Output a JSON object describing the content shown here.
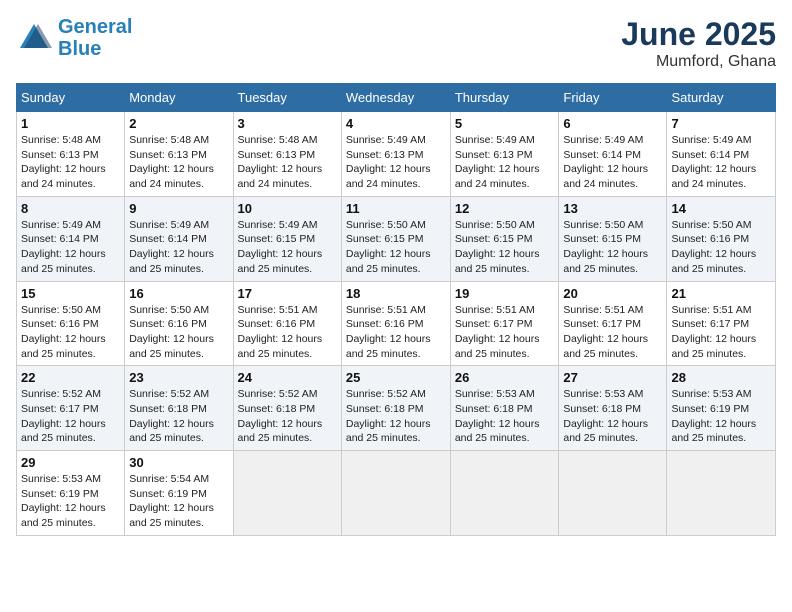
{
  "logo": {
    "line1": "General",
    "line2": "Blue"
  },
  "title": "June 2025",
  "location": "Mumford, Ghana",
  "weekdays": [
    "Sunday",
    "Monday",
    "Tuesday",
    "Wednesday",
    "Thursday",
    "Friday",
    "Saturday"
  ],
  "weeks": [
    [
      {
        "day": "1",
        "info": "Sunrise: 5:48 AM\nSunset: 6:13 PM\nDaylight: 12 hours\nand 24 minutes."
      },
      {
        "day": "2",
        "info": "Sunrise: 5:48 AM\nSunset: 6:13 PM\nDaylight: 12 hours\nand 24 minutes."
      },
      {
        "day": "3",
        "info": "Sunrise: 5:48 AM\nSunset: 6:13 PM\nDaylight: 12 hours\nand 24 minutes."
      },
      {
        "day": "4",
        "info": "Sunrise: 5:49 AM\nSunset: 6:13 PM\nDaylight: 12 hours\nand 24 minutes."
      },
      {
        "day": "5",
        "info": "Sunrise: 5:49 AM\nSunset: 6:13 PM\nDaylight: 12 hours\nand 24 minutes."
      },
      {
        "day": "6",
        "info": "Sunrise: 5:49 AM\nSunset: 6:14 PM\nDaylight: 12 hours\nand 24 minutes."
      },
      {
        "day": "7",
        "info": "Sunrise: 5:49 AM\nSunset: 6:14 PM\nDaylight: 12 hours\nand 24 minutes."
      }
    ],
    [
      {
        "day": "8",
        "info": "Sunrise: 5:49 AM\nSunset: 6:14 PM\nDaylight: 12 hours\nand 25 minutes."
      },
      {
        "day": "9",
        "info": "Sunrise: 5:49 AM\nSunset: 6:14 PM\nDaylight: 12 hours\nand 25 minutes."
      },
      {
        "day": "10",
        "info": "Sunrise: 5:49 AM\nSunset: 6:15 PM\nDaylight: 12 hours\nand 25 minutes."
      },
      {
        "day": "11",
        "info": "Sunrise: 5:50 AM\nSunset: 6:15 PM\nDaylight: 12 hours\nand 25 minutes."
      },
      {
        "day": "12",
        "info": "Sunrise: 5:50 AM\nSunset: 6:15 PM\nDaylight: 12 hours\nand 25 minutes."
      },
      {
        "day": "13",
        "info": "Sunrise: 5:50 AM\nSunset: 6:15 PM\nDaylight: 12 hours\nand 25 minutes."
      },
      {
        "day": "14",
        "info": "Sunrise: 5:50 AM\nSunset: 6:16 PM\nDaylight: 12 hours\nand 25 minutes."
      }
    ],
    [
      {
        "day": "15",
        "info": "Sunrise: 5:50 AM\nSunset: 6:16 PM\nDaylight: 12 hours\nand 25 minutes."
      },
      {
        "day": "16",
        "info": "Sunrise: 5:50 AM\nSunset: 6:16 PM\nDaylight: 12 hours\nand 25 minutes."
      },
      {
        "day": "17",
        "info": "Sunrise: 5:51 AM\nSunset: 6:16 PM\nDaylight: 12 hours\nand 25 minutes."
      },
      {
        "day": "18",
        "info": "Sunrise: 5:51 AM\nSunset: 6:16 PM\nDaylight: 12 hours\nand 25 minutes."
      },
      {
        "day": "19",
        "info": "Sunrise: 5:51 AM\nSunset: 6:17 PM\nDaylight: 12 hours\nand 25 minutes."
      },
      {
        "day": "20",
        "info": "Sunrise: 5:51 AM\nSunset: 6:17 PM\nDaylight: 12 hours\nand 25 minutes."
      },
      {
        "day": "21",
        "info": "Sunrise: 5:51 AM\nSunset: 6:17 PM\nDaylight: 12 hours\nand 25 minutes."
      }
    ],
    [
      {
        "day": "22",
        "info": "Sunrise: 5:52 AM\nSunset: 6:17 PM\nDaylight: 12 hours\nand 25 minutes."
      },
      {
        "day": "23",
        "info": "Sunrise: 5:52 AM\nSunset: 6:18 PM\nDaylight: 12 hours\nand 25 minutes."
      },
      {
        "day": "24",
        "info": "Sunrise: 5:52 AM\nSunset: 6:18 PM\nDaylight: 12 hours\nand 25 minutes."
      },
      {
        "day": "25",
        "info": "Sunrise: 5:52 AM\nSunset: 6:18 PM\nDaylight: 12 hours\nand 25 minutes."
      },
      {
        "day": "26",
        "info": "Sunrise: 5:53 AM\nSunset: 6:18 PM\nDaylight: 12 hours\nand 25 minutes."
      },
      {
        "day": "27",
        "info": "Sunrise: 5:53 AM\nSunset: 6:18 PM\nDaylight: 12 hours\nand 25 minutes."
      },
      {
        "day": "28",
        "info": "Sunrise: 5:53 AM\nSunset: 6:19 PM\nDaylight: 12 hours\nand 25 minutes."
      }
    ],
    [
      {
        "day": "29",
        "info": "Sunrise: 5:53 AM\nSunset: 6:19 PM\nDaylight: 12 hours\nand 25 minutes."
      },
      {
        "day": "30",
        "info": "Sunrise: 5:54 AM\nSunset: 6:19 PM\nDaylight: 12 hours\nand 25 minutes."
      },
      {
        "day": "",
        "info": ""
      },
      {
        "day": "",
        "info": ""
      },
      {
        "day": "",
        "info": ""
      },
      {
        "day": "",
        "info": ""
      },
      {
        "day": "",
        "info": ""
      }
    ]
  ]
}
